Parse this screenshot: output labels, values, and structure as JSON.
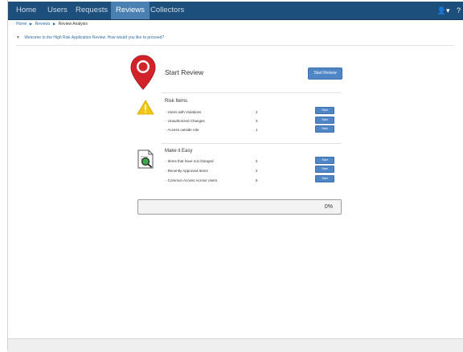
{
  "nav": {
    "items": [
      {
        "label": "Home"
      },
      {
        "label": "Users"
      },
      {
        "label": "Requests"
      },
      {
        "label": "Reviews"
      },
      {
        "label": "Collectors"
      }
    ],
    "active": "Reviews",
    "user_icon_glyph": "👤▾",
    "help_icon_glyph": "?"
  },
  "breadcrumb": {
    "items": [
      "Home",
      "Reviews",
      "Review Analysis"
    ],
    "separator": "▶"
  },
  "welcome": {
    "text": "Welcome to the High Risk Application Review. How would you like to proceed?"
  },
  "review": {
    "title": "Start Review",
    "start_button": "Start Review"
  },
  "risk_items": {
    "title": "Risk Items",
    "rows": [
      {
        "label": "- Users with Violations",
        "count": "2",
        "button": "Start"
      },
      {
        "label": "- Unauthorized Changes",
        "count": "3",
        "button": "Start"
      },
      {
        "label": "- Access outside role",
        "count": "1",
        "button": "Start"
      }
    ]
  },
  "make_easy": {
    "title": "Make it Easy",
    "rows": [
      {
        "label": "- Items that have not changed",
        "count": "5",
        "button": "Start"
      },
      {
        "label": "- Recently Approved Items",
        "count": "2",
        "button": "Start"
      },
      {
        "label": "- Common Access Across Users",
        "count": "6",
        "button": "Start"
      }
    ]
  },
  "progress": {
    "label": "0%",
    "value": 0
  },
  "colors": {
    "nav_bg": "#1d4f7c",
    "nav_active": "#4a7fb1",
    "button": "#4f86c6",
    "pin": "#d2232a",
    "warning": "#f2c511"
  }
}
